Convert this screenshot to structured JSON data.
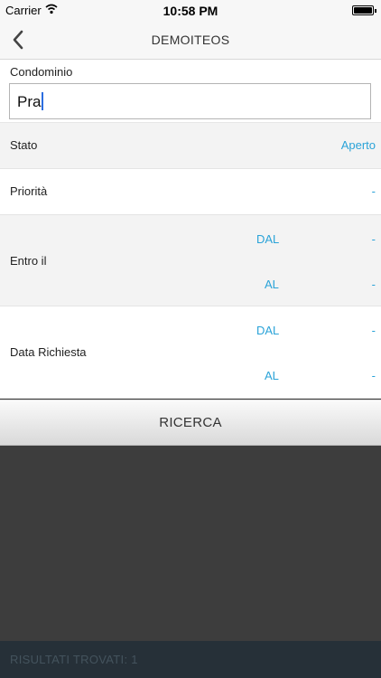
{
  "status_bar": {
    "carrier": "Carrier",
    "time": "10:58 PM"
  },
  "nav": {
    "title": "DEMOITEOS",
    "back_icon": "chevron-left-icon"
  },
  "condominio": {
    "label": "Condominio",
    "value": "Pra"
  },
  "stato": {
    "label": "Stato",
    "value": "Aperto"
  },
  "priorita": {
    "label": "Priorità",
    "value": "-"
  },
  "entro_il": {
    "label": "Entro il",
    "dal_label": "DAL",
    "dal_value": "-",
    "al_label": "AL",
    "al_value": "-"
  },
  "data_richiesta": {
    "label": "Data Richiesta",
    "dal_label": "DAL",
    "dal_value": "-",
    "al_label": "AL",
    "al_value": "-"
  },
  "search_button": {
    "label": "RICERCA"
  },
  "footer": {
    "results_text": "RISULTATI TROVATI: 1"
  },
  "colors": {
    "accent": "#2aa3d8",
    "footer_bg": "#263038",
    "results_bg": "#3d3d3d"
  }
}
